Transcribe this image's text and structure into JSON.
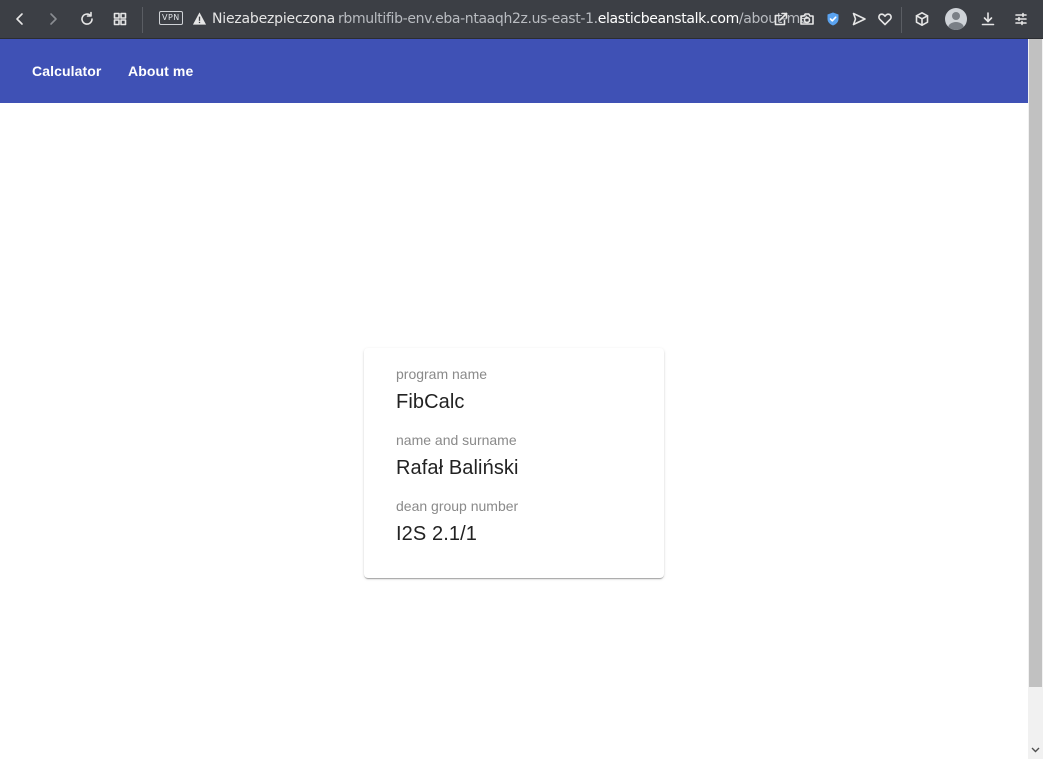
{
  "browser": {
    "vpn_label": "VPN",
    "security_label": "Niezabezpieczona",
    "url_prefix": "rbmultifib-env.eba-ntaaqh2z.us-east-1.",
    "url_host": "elasticbeanstalk.com",
    "url_path": "/about-me",
    "icons": [
      "back-icon",
      "forward-icon",
      "reload-icon",
      "tabs-grid-icon",
      "warning-icon",
      "share-icon",
      "camera-icon",
      "shield-icon",
      "send-icon",
      "heart-icon",
      "cube-icon",
      "profile-icon",
      "download-icon",
      "menu-icon"
    ]
  },
  "nav": {
    "calculator_label": "Calculator",
    "about_label": "About me",
    "bar_color": "#3f51b5"
  },
  "card": {
    "fields": [
      {
        "label": "program name",
        "value": "FibCalc"
      },
      {
        "label": "name and surname",
        "value": "Rafał Baliński"
      },
      {
        "label": "dean group number",
        "value": "I2S 2.1/1"
      }
    ]
  }
}
